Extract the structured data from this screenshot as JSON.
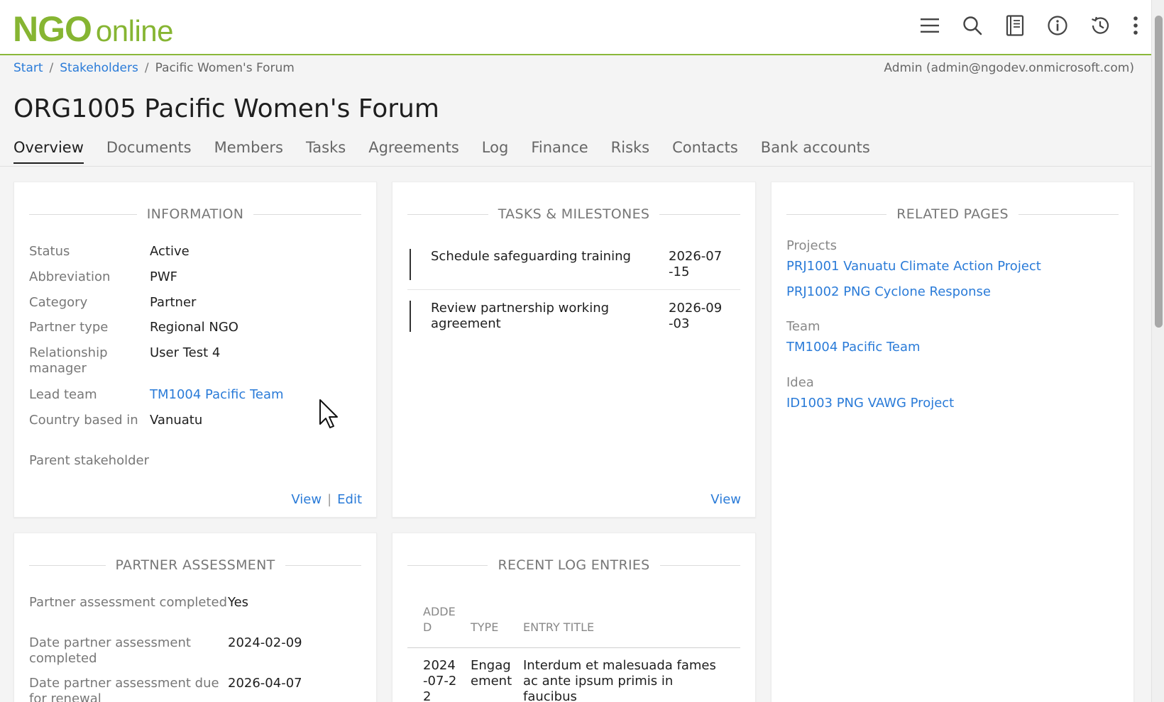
{
  "logo": {
    "part1": "NGO",
    "part2": "online"
  },
  "topbar_icons": [
    "menu-icon",
    "search-icon",
    "notebook-icon",
    "info-icon",
    "history-icon",
    "more-vertical-icon"
  ],
  "breadcrumb": {
    "items": [
      "Start",
      "Stakeholders",
      "Pacific Women's Forum"
    ],
    "separator": "/"
  },
  "user": "Admin (admin@ngodev.onmicrosoft.com)",
  "page_title": "ORG1005 Pacific Women's Forum",
  "tabs": [
    "Overview",
    "Documents",
    "Members",
    "Tasks",
    "Agreements",
    "Log",
    "Finance",
    "Risks",
    "Contacts",
    "Bank accounts"
  ],
  "active_tab": "Overview",
  "information": {
    "title": "INFORMATION",
    "rows": [
      {
        "label": "Status",
        "value": "Active"
      },
      {
        "label": "Abbreviation",
        "value": "PWF"
      },
      {
        "label": "Category",
        "value": "Partner"
      },
      {
        "label": "Partner type",
        "value": "Regional NGO"
      },
      {
        "label": "Relationship manager",
        "value": "User Test 4"
      },
      {
        "label": "Lead team",
        "value": "TM1004 Pacific Team"
      },
      {
        "label": "Country based in",
        "value": "Vanuatu"
      },
      {
        "label": "Parent stakeholder",
        "value": ""
      }
    ],
    "view_label": "View",
    "divider": "|",
    "edit_label": "Edit"
  },
  "tasks": {
    "title": "TASKS & MILESTONES",
    "items": [
      {
        "name": "Schedule safeguarding training",
        "date": "2026-07-15"
      },
      {
        "name": "Review partnership working agreement",
        "date": "2026-09-03"
      }
    ],
    "view_label": "View"
  },
  "related": {
    "title": "RELATED PAGES",
    "projects_label": "Projects",
    "projects": [
      "PRJ1001 Vanuatu Climate Action Project",
      "PRJ1002 PNG Cyclone Response"
    ],
    "team_label": "Team",
    "team": "TM1004 Pacific Team",
    "idea_label": "Idea",
    "idea": "ID1003 PNG VAWG Project"
  },
  "partner_assessment": {
    "title": "PARTNER ASSESSMENT",
    "rows": [
      {
        "label": "Partner assessment completed",
        "value": "Yes"
      },
      {
        "label": "Date partner assessment completed",
        "value": "2024-02-09"
      },
      {
        "label": "Date partner assessment due for renewal",
        "value": "2026-04-07"
      }
    ]
  },
  "log": {
    "title": "RECENT LOG ENTRIES",
    "columns": [
      "ADDED",
      "TYPE",
      "ENTRY TITLE"
    ],
    "rows": [
      {
        "added": "2024-07-22",
        "type": "Engagement",
        "title": "Interdum et malesuada fames ac ante ipsum primis in faucibus"
      }
    ]
  },
  "colors": {
    "brand": "#86b532",
    "link": "#2a7bd8",
    "text": "#1e1e1e",
    "muted": "#777777"
  }
}
